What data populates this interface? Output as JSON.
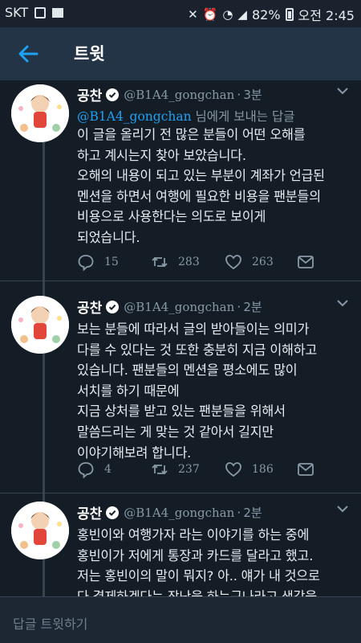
{
  "status_bar": {
    "carrier": "SKT",
    "battery": "82%",
    "clock": "오전 2:45"
  },
  "header": {
    "title": "트윗"
  },
  "tweets": [
    {
      "name": "공찬",
      "handle": "@B1A4_gongchan",
      "sep": "·",
      "time": "3분",
      "reply_to_handle": "@B1A4_gongchan",
      "reply_to_text": " 님에게 보내는 답글",
      "lines": [
        "이 글을 올리기 전 많은 분들이 어떤 오해를",
        "하고 계시는지 찾아 보았습니다.",
        "오해의 내용이 되고 있는 부분이 계좌가 언급된",
        "멘션을 하면서 여행에 필요한 비용을 팬분들의",
        "비용으로 사용한다는 의도로 보이게",
        "되었습니다."
      ],
      "replies": "15",
      "retweets": "283",
      "likes": "263"
    },
    {
      "name": "공찬",
      "handle": "@B1A4_gongchan",
      "sep": "·",
      "time": "2분",
      "lines": [
        "보는 분들에 따라서 글의 받아들이는 의미가",
        "다를 수 있다는 것 또한 충분히 지금 이해하고",
        "있습니다. 팬분들의 멘션을 평소에도 많이",
        "서치를 하기 때문에",
        "지금 상처를 받고 있는 팬분들을 위해서",
        "말씀드리는 게 맞는 것 같아서 길지만",
        "이야기해보려 합니다."
      ],
      "replies": "4",
      "retweets": "237",
      "likes": "186"
    },
    {
      "name": "공찬",
      "handle": "@B1A4_gongchan",
      "sep": "·",
      "time": "2분",
      "lines": [
        "홍빈이와 여행가자 라는 이야기를 하는 중에",
        "홍빈이가 저에게 통장과 카드를 달라고 했고.",
        "저는 홍빈이의 말이 뭐지? 아.. 얘가 내 것으로",
        "다 결제하겠다는 장난을 하는구나라고 생각을"
      ]
    }
  ],
  "reply_bar": {
    "placeholder": "답글 트윗하기"
  },
  "colors": {
    "background": "#141d26",
    "header": "#243447",
    "accent": "#1da1f2",
    "muted": "#8899a6"
  },
  "icons": [
    "back-arrow-icon",
    "verified-badge-icon",
    "chevron-down-icon",
    "reply-icon",
    "retweet-icon",
    "like-icon",
    "message-icon"
  ]
}
